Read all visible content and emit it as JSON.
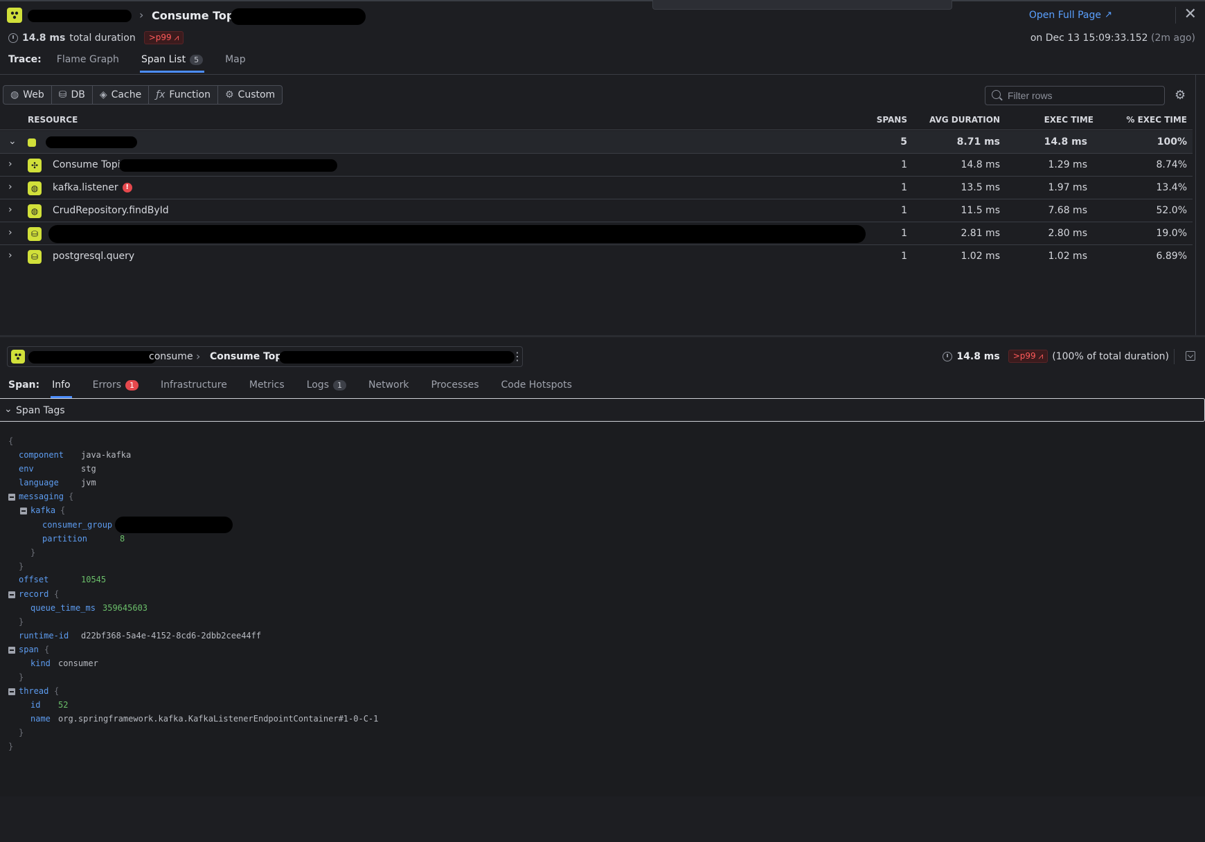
{
  "header": {
    "title": "Consume Topic",
    "duration_value": "14.8 ms",
    "duration_suffix": "total duration",
    "p99_badge": ">p99",
    "open_full_page": "Open Full Page",
    "date": "on Dec 13 15:09:33.152",
    "date_ago": "(2m ago)"
  },
  "trace_tabs": {
    "label": "Trace:",
    "items": [
      {
        "label": "Flame Graph"
      },
      {
        "label": "Span List",
        "count": "5",
        "active": true
      },
      {
        "label": "Map"
      }
    ]
  },
  "filters": {
    "buttons": [
      {
        "label": "Web",
        "icon": "globe-icon"
      },
      {
        "label": "DB",
        "icon": "database-icon"
      },
      {
        "label": "Cache",
        "icon": "layers-icon"
      },
      {
        "label": "Function",
        "icon": "function-icon"
      },
      {
        "label": "Custom",
        "icon": "custom-icon"
      }
    ],
    "search_placeholder": "Filter rows"
  },
  "table": {
    "columns": [
      "RESOURCE",
      "SPANS",
      "AVG DURATION",
      "EXEC TIME",
      "% EXEC TIME"
    ],
    "rows": [
      {
        "resource": "",
        "spans": "5",
        "avg": "8.71 ms",
        "exec": "14.8 ms",
        "pct": "100%",
        "icon": "service-square-icon"
      },
      {
        "resource": "Consume Topic",
        "spans": "1",
        "avg": "14.8 ms",
        "exec": "1.29 ms",
        "pct": "8.74%",
        "icon": "kafka-icon"
      },
      {
        "resource": "kafka.listener",
        "spans": "1",
        "avg": "13.5 ms",
        "exec": "1.97 ms",
        "pct": "13.4%",
        "icon": "globe-icon",
        "error": "!"
      },
      {
        "resource": "CrudRepository.findById",
        "spans": "1",
        "avg": "11.5 ms",
        "exec": "7.68 ms",
        "pct": "52.0%",
        "icon": "globe-icon"
      },
      {
        "resource": "",
        "spans": "1",
        "avg": "2.81 ms",
        "exec": "2.80 ms",
        "pct": "19.0%",
        "icon": "database-icon"
      },
      {
        "resource": "postgresql.query",
        "spans": "1",
        "avg": "1.02 ms",
        "exec": "1.02 ms",
        "pct": "6.89%",
        "icon": "database-icon"
      }
    ]
  },
  "span": {
    "bc_consume": "consume",
    "bc_title": "Consume Topic",
    "duration": "14.8 ms",
    "p99_badge": ">p99",
    "pct_text": "(100% of total duration)",
    "tabs_label": "Span:",
    "tabs": [
      {
        "label": "Info",
        "active": true
      },
      {
        "label": "Errors",
        "count": "1"
      },
      {
        "label": "Infrastructure"
      },
      {
        "label": "Metrics"
      },
      {
        "label": "Logs",
        "count": "1"
      },
      {
        "label": "Network"
      },
      {
        "label": "Processes"
      },
      {
        "label": "Code Hotspots"
      }
    ],
    "section_title": "Span Tags"
  },
  "tags": {
    "open_brace": "{",
    "close_brace": "}",
    "component_k": "component",
    "component_v": "java-kafka",
    "env_k": "env",
    "env_v": "stg",
    "language_k": "language",
    "language_v": "jvm",
    "messaging_k": "messaging",
    "kafka_k": "kafka",
    "consumer_group_k": "consumer_group",
    "partition_k": "partition",
    "partition_v": "8",
    "offset_k": "offset",
    "offset_v": "10545",
    "record_k": "record",
    "queue_time_k": "queue_time_ms",
    "queue_time_v": "359645603",
    "runtime_k": "runtime-id",
    "runtime_v": "d22bf368-5a4e-4152-8cd6-2dbb2cee44ff",
    "span_k": "span",
    "kind_k": "kind",
    "kind_v": "consumer",
    "thread_k": "thread",
    "id_k": "id",
    "id_v": "52",
    "name_k": "name",
    "name_v": "org.springframework.kafka.KafkaListenerEndpointContainer#1-0-C-1"
  },
  "colors": {
    "accent": "#4c8dff",
    "service": "#d1e03a",
    "error": "#e5484d",
    "json_key": "#5d9cf0",
    "json_number": "#6bbf6a"
  }
}
